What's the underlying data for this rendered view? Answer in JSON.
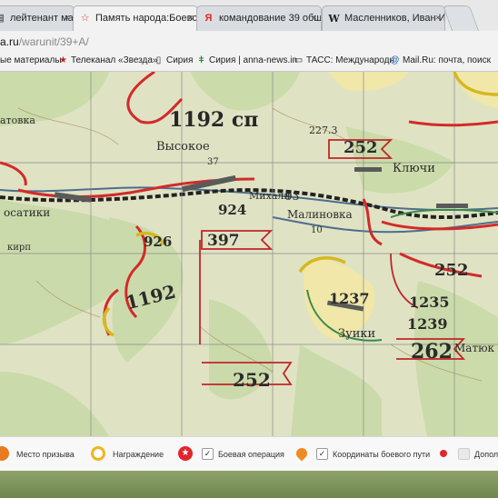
{
  "tabs": [
    {
      "label": "лейтенант масс",
      "icon": "document-icon",
      "active": false
    },
    {
      "label": "Память народа:Боевой",
      "icon": "star-icon",
      "active": true
    },
    {
      "label": "командование 39 общ",
      "icon": "yandex-icon",
      "active": false
    },
    {
      "label": "Масленников, Иван Ив",
      "icon": "wikipedia-icon",
      "active": false
    }
  ],
  "tab_close": "×",
  "address": {
    "host": "a.ru",
    "path": "/warunit/39+A/"
  },
  "bookmarks": [
    {
      "label": "ые материалы",
      "icon": ""
    },
    {
      "label": "Телеканал «Звезда»",
      "icon": "star-icon"
    },
    {
      "label": "Сирия",
      "icon": "page-icon"
    },
    {
      "label": "Сирия | anna-news.in",
      "icon": "anna-icon"
    },
    {
      "label": "ТАСС: Международн",
      "icon": "tass-icon"
    },
    {
      "label": "Mail.Ru: почта, поиск",
      "icon": "mail-icon"
    }
  ],
  "map": {
    "labels": [
      {
        "text": "атовка"
      },
      {
        "text": "1192 сп"
      },
      {
        "text": "Высокое"
      },
      {
        "text": "252"
      },
      {
        "text": "Ключи"
      },
      {
        "text": "227.3"
      },
      {
        "text": "37"
      },
      {
        "text": "Михали"
      },
      {
        "text": "93"
      },
      {
        "text": "924"
      },
      {
        "text": "Малиновка"
      },
      {
        "text": "осатики"
      },
      {
        "text": "926"
      },
      {
        "text": "397"
      },
      {
        "text": "кирп"
      },
      {
        "text": "1192"
      },
      {
        "text": "1237"
      },
      {
        "text": "1235"
      },
      {
        "text": "1239"
      },
      {
        "text": "Зуики"
      },
      {
        "text": "Матюк"
      },
      {
        "text": "252"
      },
      {
        "text": "262"
      },
      {
        "text": "252"
      },
      {
        "text": "10"
      }
    ]
  },
  "toolbar": {
    "items": [
      {
        "label": "Место призыва",
        "icon": "pin-icon",
        "color": "#e87b1e"
      },
      {
        "label": "Награждение",
        "icon": "award-icon",
        "color": "#f2b51c"
      },
      {
        "label": "Боевая операция",
        "icon": "battle-star-icon",
        "color": "#e2252b",
        "checked": true
      },
      {
        "label": "Координаты боевого пути",
        "icon": "location-icon",
        "color": "#f08a24",
        "checked": true
      },
      {
        "label": "Дополн",
        "icon": "extra-icon",
        "color": "#e2252b",
        "checked": false
      }
    ],
    "check_mark": "✓"
  }
}
